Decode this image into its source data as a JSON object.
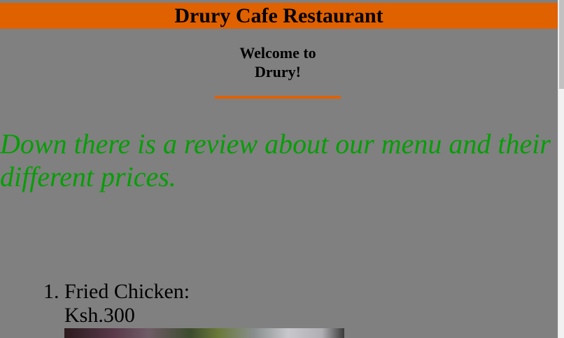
{
  "header": {
    "title": "Drury Cafe Restaurant"
  },
  "welcome": {
    "line1": "Welcome to",
    "line2": "Drury!"
  },
  "tagline": "Down there is a review about our menu and their different prices.",
  "menu": {
    "items": [
      {
        "number": "1.",
        "name": "Fried Chicken:",
        "price": "Ksh.300"
      }
    ]
  },
  "colors": {
    "accent": "#e06100",
    "tagline": "#069e06",
    "background": "#808080"
  }
}
